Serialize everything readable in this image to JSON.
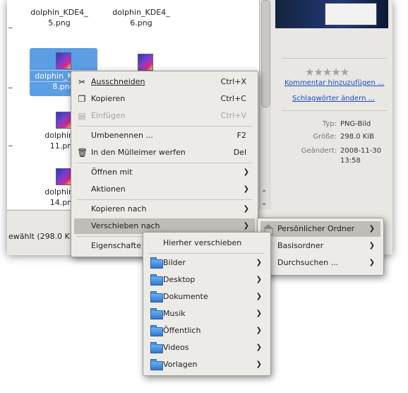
{
  "files": {
    "row1": [
      "dolphin_KDE4_\n5.png",
      "dolphin_KDE4_\n6.png"
    ],
    "selected_partial": "dolphin_K",
    "selected_suffix": "8.png",
    "left_items": [
      {
        "label": "dolphin_KDE4_",
        "sub": "8.png"
      },
      {
        "label": "dolphin_K",
        "sub": "11.png"
      },
      {
        "label": "dolphin_K",
        "sub": "14.png"
      }
    ],
    "left_fragment": "_"
  },
  "status": {
    "text": "ewählt (298.0 Ki"
  },
  "info": {
    "add_comment": "Kommentar hinzuzufügen ...",
    "change_tags": "Schlagwörter ändern ...",
    "type_label": "Typ:",
    "type_value": "PNG-Bild",
    "size_label": "Größe:",
    "size_value": "298.0 KiB",
    "changed_label": "Geändert:",
    "changed_value_1": "2008-11-30",
    "changed_value_2": "13:58"
  },
  "context_menu": {
    "items": [
      {
        "label": "Ausschneiden",
        "shortcut": "Ctrl+X"
      },
      {
        "label": "Kopieren",
        "shortcut": "Ctrl+C"
      },
      {
        "label": "Einfügen",
        "shortcut": "Ctrl+V"
      },
      {
        "label": "Umbenennen ...",
        "shortcut": "F2"
      },
      {
        "label": "In den Mülleimer werfen",
        "shortcut": "Del"
      },
      {
        "label": "Öffnen mit"
      },
      {
        "label": "Aktionen"
      },
      {
        "label": "Kopieren nach"
      },
      {
        "label": "Verschieben nach"
      },
      {
        "label": "Eigenschafte"
      }
    ]
  },
  "move_menu": {
    "items": [
      {
        "label": "Persönlicher Ordner"
      },
      {
        "label": "Basisordner"
      },
      {
        "label": "Durchsuchen ..."
      }
    ]
  },
  "folder_menu": {
    "move_here": "Hierher verschieben",
    "folders": [
      "Bilder",
      "Desktop",
      "Dokumente",
      "Musik",
      "Öffentlich",
      "Videos",
      "Vorlagen"
    ]
  }
}
